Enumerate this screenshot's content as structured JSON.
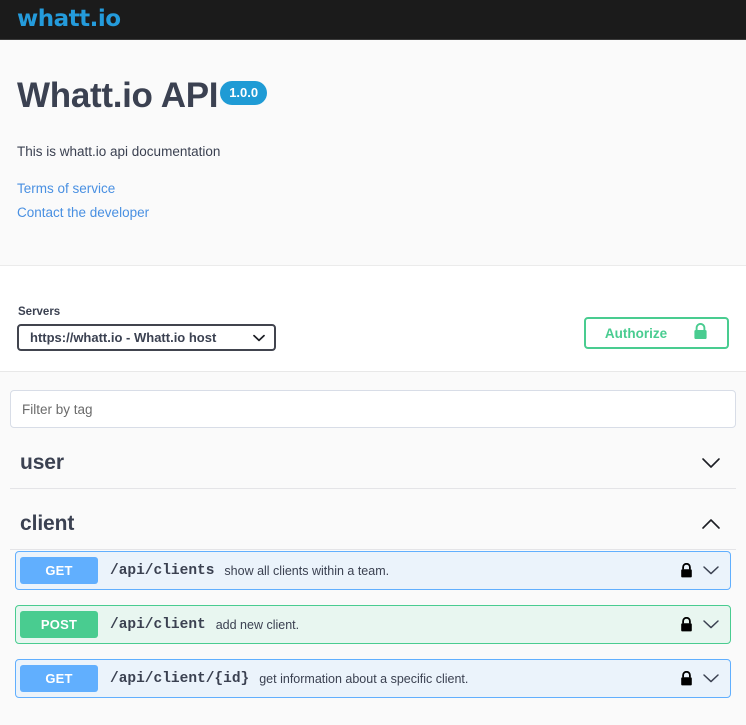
{
  "topbar": {
    "logo_text": "whatt.io",
    "logo_color": "#249bdb",
    "bg_color": "#1b1b1b"
  },
  "info": {
    "title": "Whatt.io API",
    "version": "1.0.0",
    "version_badge_color": "#1f9bd5",
    "description": "This is whatt.io api documentation",
    "links": [
      {
        "label": "Terms of service",
        "name": "terms-of-service-link"
      },
      {
        "label": "Contact the developer",
        "name": "contact-developer-link"
      }
    ],
    "link_color": "#4990e2"
  },
  "servers": {
    "label": "Servers",
    "selected": "https://whatt.io - Whatt.io host",
    "options": [
      "https://whatt.io - Whatt.io host"
    ]
  },
  "authorize": {
    "label": "Authorize",
    "icon": "lock-icon",
    "color": "#49cc90"
  },
  "filter": {
    "placeholder": "Filter by tag",
    "value": ""
  },
  "tags": [
    {
      "name": "user",
      "expanded": false,
      "arrow": "chevron-down-icon"
    },
    {
      "name": "client",
      "expanded": true,
      "arrow": "chevron-up-icon"
    }
  ],
  "operations": [
    {
      "method": "GET",
      "method_class": "get",
      "path": "/api/clients",
      "summary": "show all clients within a team.",
      "locked": true,
      "arrow": "chevron-down-icon",
      "method_color": "#61affe"
    },
    {
      "method": "POST",
      "method_class": "post",
      "path": "/api/client",
      "summary": "add new client.",
      "locked": true,
      "arrow": "chevron-down-icon",
      "method_color": "#49cc90"
    },
    {
      "method": "GET",
      "method_class": "get",
      "path": "/api/client/{id}",
      "summary": "get information about a specific client.",
      "locked": true,
      "arrow": "chevron-down-icon",
      "method_color": "#61affe"
    }
  ]
}
